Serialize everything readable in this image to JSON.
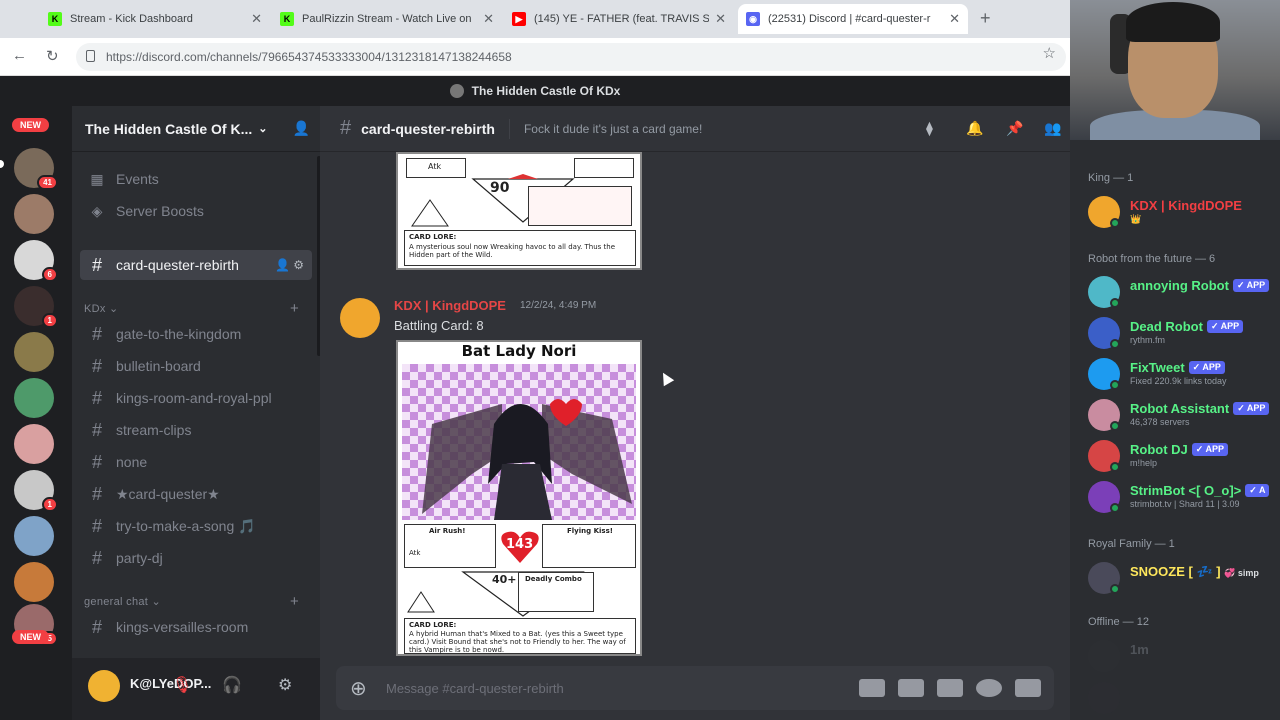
{
  "browser": {
    "tabs": [
      {
        "title": "Stream - Kick Dashboard",
        "icon": "kick-icon",
        "color": "#53fc18"
      },
      {
        "title": "PaulRizzin Stream - Watch Live on",
        "icon": "kick-icon",
        "color": "#53fc18"
      },
      {
        "title": "(145) YE - FATHER (feat. TRAVIS S",
        "icon": "youtube-icon",
        "color": "#ff0000"
      },
      {
        "title": "(22531) Discord | #card-quester-r",
        "icon": "discord-icon",
        "color": "#5865f2"
      }
    ],
    "url": "https://discord.com/channels/796654374533333004/1312318147138244658"
  },
  "discord": {
    "window_title": "The Hidden Castle Of KDx",
    "guild_name": "The Hidden Castle Of K...",
    "rail": {
      "new_label_top": "NEW",
      "new_label_bottom": "NEW",
      "badges": [
        "41",
        "6",
        "1",
        "1",
        "15"
      ]
    },
    "sidebar": {
      "events": "Events",
      "boosts": "Server Boosts",
      "active_channel": "card-quester-rebirth",
      "category_kdx": "KDx",
      "channels": [
        "gate-to-the-kingdom",
        "bulletin-board",
        "kings-room-and-royal-ppl",
        "stream-clips",
        "none",
        "★card-quester★",
        "try-to-make-a-song 🎵",
        "party-dj"
      ],
      "category_general": "general chat",
      "general_channels": [
        "kings-versailles-room"
      ]
    },
    "user": {
      "name": "K@LYeDOP..."
    },
    "channel": {
      "name": "card-quester-rebirth",
      "topic": "Fock it dude it's just a card game!"
    },
    "message": {
      "author": "KDX | KingdDOPE",
      "time": "12/2/24, 4:49 PM",
      "text": "Battling Card: 8"
    },
    "card_top": {
      "stat": "90",
      "lore_label": "CARD LORE:",
      "lore": "A mysterious soul now Wreaking havoc to all day. Thus the Hidden part of the Wild.",
      "atk": "Atk"
    },
    "card_main": {
      "title": "Bat Lady Nori",
      "hp": "143",
      "stat": "40+",
      "atk": "Atk",
      "skill_left": "Air Rush!",
      "skill_right": "Flying Kiss!",
      "skill_bottom": "Deadly Combo",
      "lore_label": "CARD LORE:",
      "lore": "A hybrid Human that's Mixed to a Bat. (yes this a Sweet type card.) Visit Bound that she's not to Friendly to her. The way of this Vampire is to be nowd."
    },
    "composer": {
      "placeholder": "Message #card-quester-rebirth"
    },
    "members": {
      "king_cat": "King — 1",
      "king": {
        "name": "KDX | KingdDOPE",
        "emoji": "👑",
        "color": "#f23f43"
      },
      "robots_cat": "Robot from the future — 6",
      "robots": [
        {
          "name": "annoying Robot",
          "tag": "✓ APP",
          "sub": ""
        },
        {
          "name": "Dead Robot",
          "tag": "✓ APP",
          "sub": "rythm.fm"
        },
        {
          "name": "FixTweet",
          "tag": "✓ APP",
          "sub": "Fixed 220.9k links today"
        },
        {
          "name": "Robot Assistant",
          "tag": "✓ APP",
          "sub": "46,378 servers"
        },
        {
          "name": "Robot DJ",
          "tag": "✓ APP",
          "sub": "m!help"
        },
        {
          "name": "StrimBot <[ O_o]>",
          "tag": "✓ A",
          "sub": "strimbot.tv | Shard 11 | 3.09"
        }
      ],
      "royal_cat": "Royal Family — 1",
      "royal": {
        "name": "SNOOZE [ 💤 ]",
        "sub": "💞 simp"
      },
      "offline_cat": "Offline — 12",
      "offline_first": "1m"
    },
    "colors": {
      "bg": "#313338",
      "sidebar": "#2b2d31",
      "accent": "#5865f2",
      "green": "#23a55a",
      "red": "#f23f43"
    }
  }
}
